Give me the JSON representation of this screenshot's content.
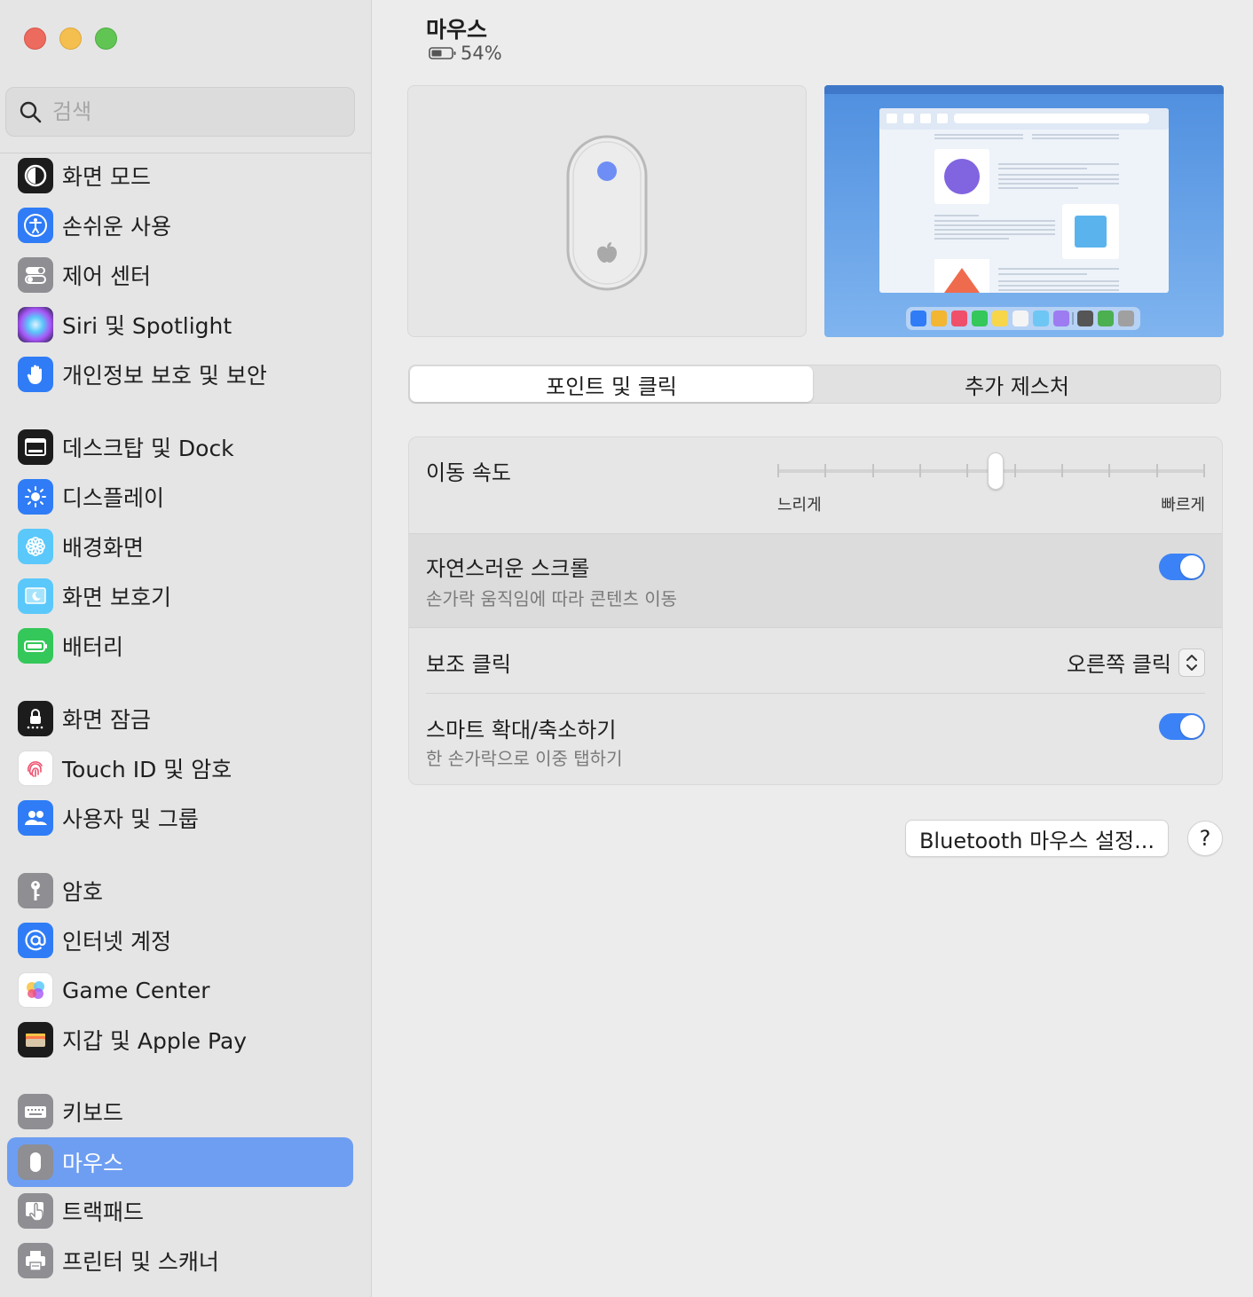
{
  "search": {
    "placeholder": "검색"
  },
  "sidebar": {
    "items": [
      {
        "label": "화면 모드",
        "icon": "appearance-icon",
        "color": "#1c1c1c"
      },
      {
        "label": "손쉬운 사용",
        "icon": "accessibility-icon",
        "color": "#2f7cf6"
      },
      {
        "label": "제어 센터",
        "icon": "control-center-icon",
        "color": "#8e8e93"
      },
      {
        "label": "Siri 및 Spotlight",
        "icon": "siri-icon",
        "color": "#5b3fa3"
      },
      {
        "label": "개인정보 보호 및 보안",
        "icon": "hand-icon",
        "color": "#2f7cf6"
      },
      {
        "label": "데스크탑 및 Dock",
        "icon": "desktop-dock-icon",
        "color": "#1c1c1c"
      },
      {
        "label": "디스플레이",
        "icon": "display-brightness-icon",
        "color": "#2f7cf6"
      },
      {
        "label": "배경화면",
        "icon": "wallpaper-flower-icon",
        "color": "#5ac8fa"
      },
      {
        "label": "화면 보호기",
        "icon": "screensaver-icon",
        "color": "#5ac8fa"
      },
      {
        "label": "배터리",
        "icon": "battery-icon",
        "color": "#34c759"
      },
      {
        "label": "화면 잠금",
        "icon": "lock-icon",
        "color": "#1c1c1c"
      },
      {
        "label": "Touch ID 및 암호",
        "icon": "fingerprint-icon",
        "color": "#ffffff"
      },
      {
        "label": "사용자 및 그룹",
        "icon": "users-icon",
        "color": "#2f7cf6"
      },
      {
        "label": "암호",
        "icon": "key-icon",
        "color": "#8e8e93"
      },
      {
        "label": "인터넷 계정",
        "icon": "at-sign-icon",
        "color": "#2f7cf6"
      },
      {
        "label": "Game Center",
        "icon": "game-center-icon",
        "color": "#ffffff"
      },
      {
        "label": "지갑 및 Apple Pay",
        "icon": "wallet-icon",
        "color": "#1c1c1c"
      },
      {
        "label": "키보드",
        "icon": "keyboard-icon",
        "color": "#8e8e93"
      },
      {
        "label": "마우스",
        "icon": "mouse-icon",
        "color": "#8e8e93",
        "selected": true
      },
      {
        "label": "트랙패드",
        "icon": "trackpad-icon",
        "color": "#8e8e93"
      },
      {
        "label": "프린터 및 스캐너",
        "icon": "printer-icon",
        "color": "#8e8e93"
      }
    ]
  },
  "header": {
    "title": "마우스",
    "battery": "54%"
  },
  "tabs": [
    {
      "label": "포인트 및 클릭",
      "active": true
    },
    {
      "label": "추가 제스처",
      "active": false
    }
  ],
  "settings": {
    "tracking_speed": {
      "label": "이동 속도",
      "min_label": "느리게",
      "max_label": "빠르게",
      "value": 0.51,
      "ticks": 10
    },
    "natural_scroll": {
      "label": "자연스러운 스크롤",
      "description": "손가락 움직임에 따라 콘텐츠 이동",
      "enabled": true
    },
    "secondary_click": {
      "label": "보조 클릭",
      "value": "오른쪽 클릭"
    },
    "smart_zoom": {
      "label": "스마트 확대/축소하기",
      "description": "한 손가락으로 이중 탭하기",
      "enabled": true
    }
  },
  "buttons": {
    "bluetooth": "Bluetooth 마우스 설정...",
    "help": "?"
  },
  "colors": {
    "accent": "#3b82f6",
    "selection": "#6e9ef2"
  }
}
